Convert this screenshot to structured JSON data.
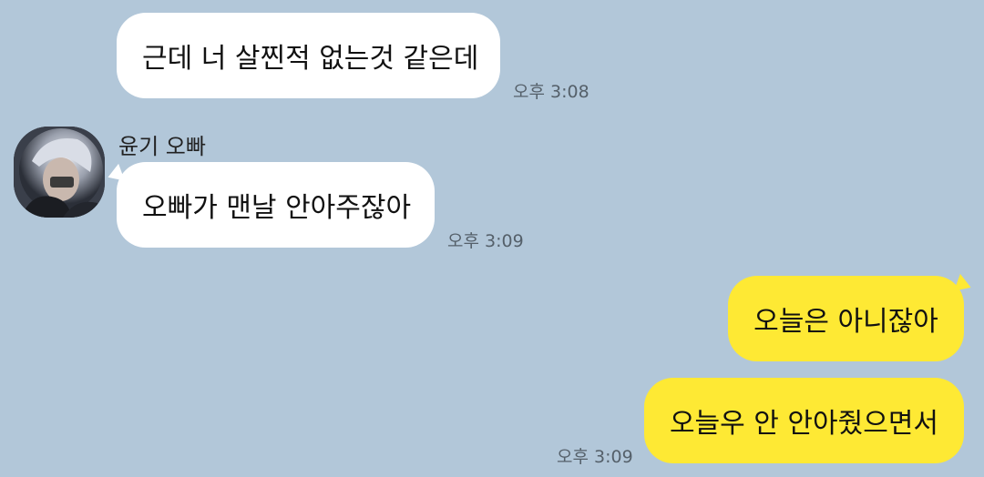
{
  "messages": [
    {
      "direction": "incoming",
      "text": "근데 너 살찐적 없는것 같은데",
      "time": "오후 3:08"
    },
    {
      "direction": "incoming",
      "sender": "윤기 오빠",
      "text": "오빠가 맨날 안아주잖아",
      "time": "오후 3:09"
    },
    {
      "direction": "outgoing",
      "text": "오늘은 아니잖아"
    },
    {
      "direction": "outgoing",
      "text": "오늘우 안 안아줬으면서",
      "time": "오후 3:09"
    }
  ],
  "colors": {
    "background": "#b2c7d9",
    "incoming_bubble": "#ffffff",
    "outgoing_bubble": "#fee934"
  },
  "icons": {
    "avatar": "profile-photo-icon"
  }
}
